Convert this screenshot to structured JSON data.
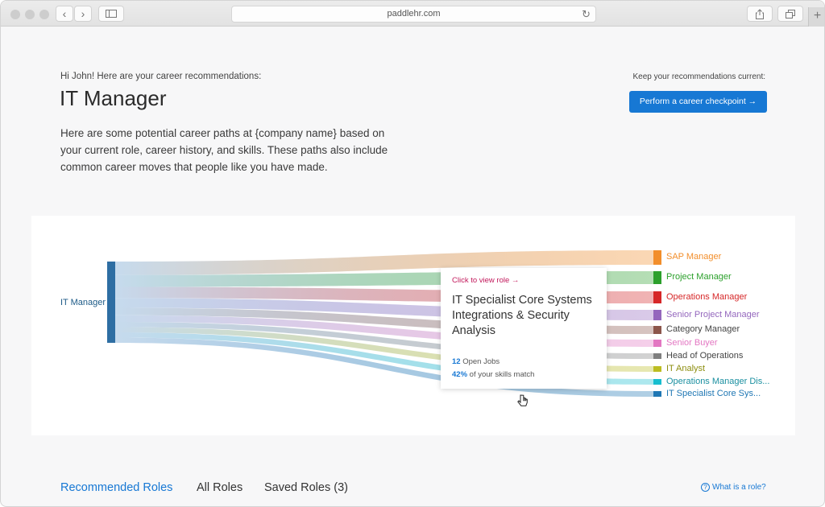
{
  "browser": {
    "url": "paddlehr.com",
    "back_icon": "‹",
    "forward_icon": "›",
    "reload_icon": "↻",
    "new_tab_icon": "+"
  },
  "header": {
    "greeting": "Hi John! Here are your career recommendations:",
    "title": "IT Manager",
    "intro": "Here are some potential career paths at {company name} based on your current role, career history, and skills. These paths also include common career moves that people like you have made.",
    "keep_current": "Keep your recommendations current:",
    "checkpoint_button": "Perform a career checkpoint →"
  },
  "chart_data": {
    "type": "sankey",
    "source": "IT Manager",
    "targets": [
      {
        "name": "SAP Manager",
        "color": "#f28e2b"
      },
      {
        "name": "Project Manager",
        "color": "#2ca02c"
      },
      {
        "name": "Operations Manager",
        "color": "#d62728"
      },
      {
        "name": "Senior Project Manager",
        "color": "#9467bd"
      },
      {
        "name": "Category Manager",
        "color": "#8c564b"
      },
      {
        "name": "Senior Buyer",
        "color": "#e377c2"
      },
      {
        "name": "Head of Operations",
        "color": "#7f7f7f"
      },
      {
        "name": "IT Analyst",
        "color": "#bcbd22"
      },
      {
        "name": "Operations Manager Dis...",
        "color": "#17becf"
      },
      {
        "name": "IT Specialist Core Sys...",
        "color": "#1f77b4"
      }
    ]
  },
  "tooltip": {
    "link": "Click to view role →",
    "title": "IT Specialist Core Systems Integrations & Security Analysis",
    "open_jobs_count": "12",
    "open_jobs_label": " Open Jobs",
    "skills_match_pct": "42%",
    "skills_match_label": " of your skills match"
  },
  "tabs": [
    {
      "label": "Recommended Roles",
      "active": true
    },
    {
      "label": "All Roles",
      "active": false
    },
    {
      "label": "Saved Roles (3)",
      "active": false
    }
  ],
  "help_link": "What is a role?"
}
